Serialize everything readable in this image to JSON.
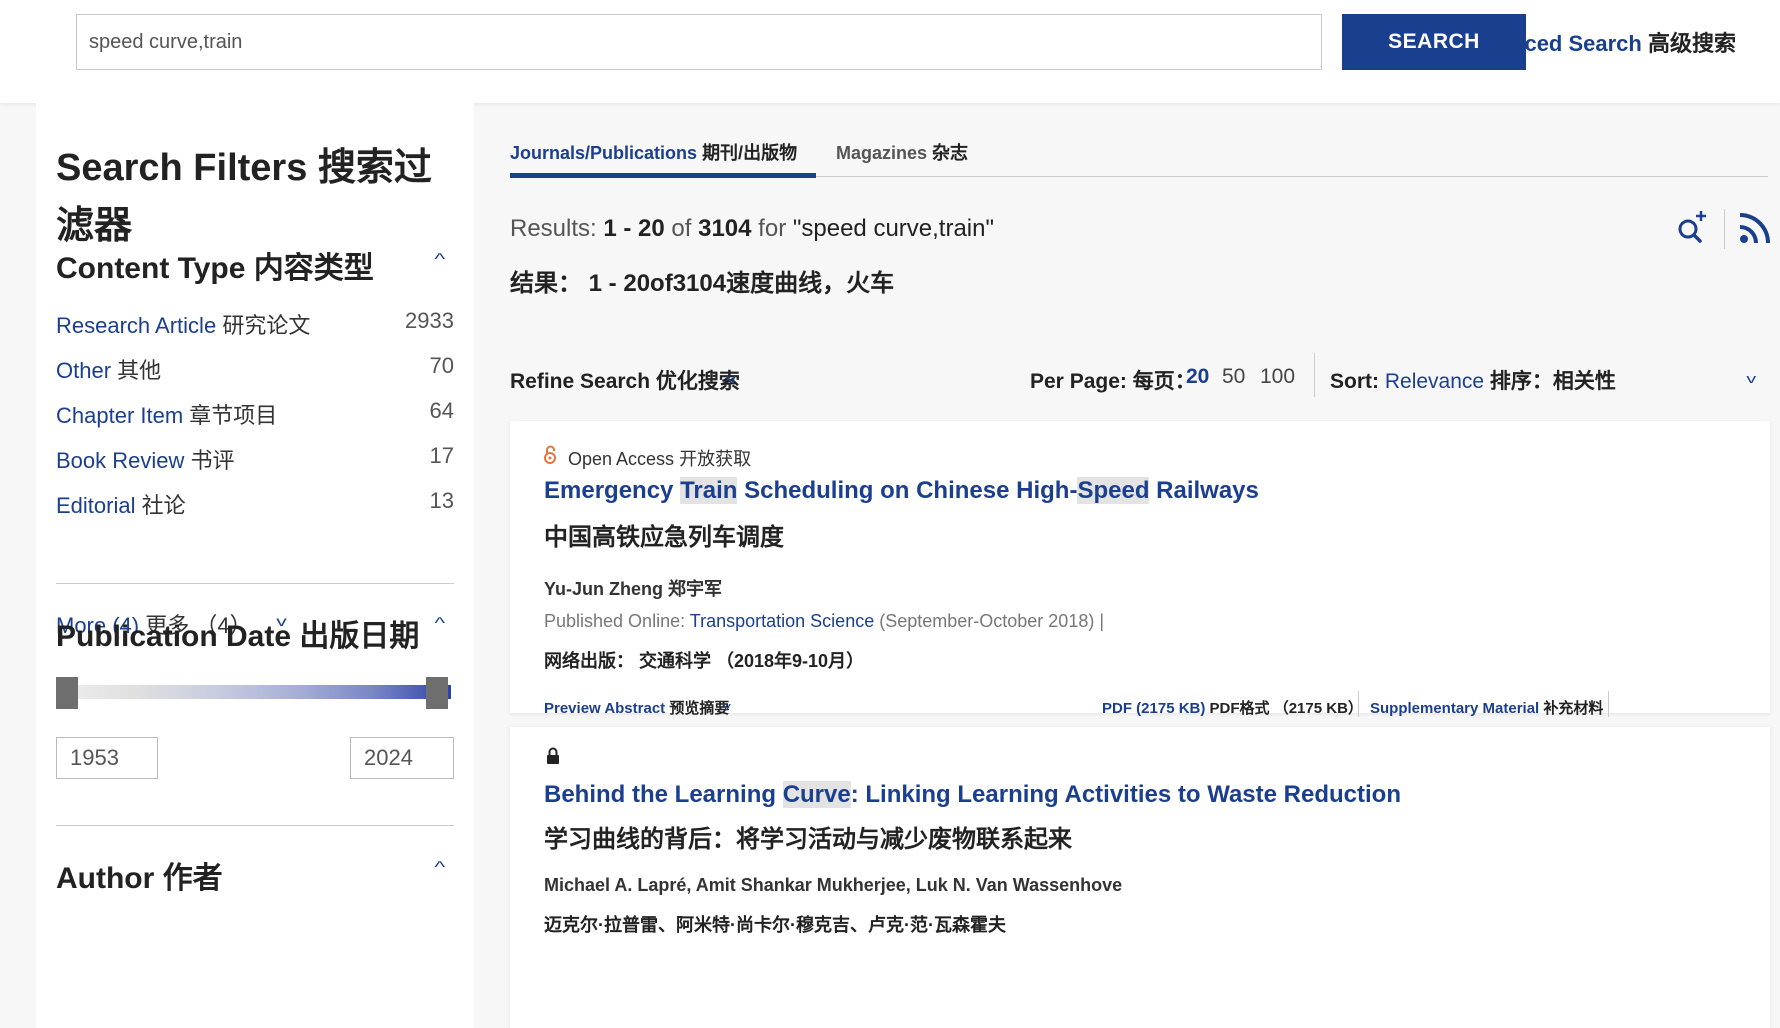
{
  "search": {
    "value": "speed curve,train",
    "button_label": "SEARCH",
    "advanced_label": "Advanced Search",
    "advanced_label_cn": "高级搜索"
  },
  "sidebar": {
    "title": "Search Filters 搜索过滤器",
    "content_type": {
      "heading": "Content Type 内容类型",
      "items": [
        {
          "label": "Research Article",
          "label_cn": "研究论文",
          "count": "2933"
        },
        {
          "label": "Other",
          "label_cn": "其他",
          "count": "70"
        },
        {
          "label": "Chapter Item",
          "label_cn": "章节项目",
          "count": "64"
        },
        {
          "label": "Book Review",
          "label_cn": "书评",
          "count": "17"
        },
        {
          "label": "Editorial",
          "label_cn": "社论",
          "count": "13"
        }
      ],
      "more_label": "More (4)",
      "more_label_cn": "更多 （4）"
    },
    "publication_date": {
      "heading": "Publication Date 出版日期",
      "from_year": "1953",
      "to_year": "2024"
    },
    "author": {
      "heading": "Author 作者"
    }
  },
  "tabs": [
    {
      "label": "Journals/Publications",
      "label_cn": "期刊/出版物"
    },
    {
      "label": "Magazines",
      "label_cn": "杂志"
    }
  ],
  "results": {
    "prefix": "Results:",
    "range": "1 - 20",
    "of": "of",
    "total": "3104",
    "for": "for",
    "query": "\"speed curve,train\"",
    "summary_cn": "结果： 1 - 20of3104速度曲线，火车"
  },
  "toolbar": {
    "refine_label": "Refine Search",
    "refine_label_cn": "优化搜索",
    "per_page_label": "Per Page: 每页：",
    "per_page_options": [
      "20",
      "50",
      "100"
    ],
    "sort_label": "Sort:",
    "sort_value": "Relevance",
    "sort_label_cn": "排序：相关性"
  },
  "articles": [
    {
      "access": "Open Access",
      "access_cn": "开放获取",
      "title_parts": [
        "Emergency ",
        "Train",
        " Scheduling on Chinese High-",
        "Speed",
        " Railways"
      ],
      "title_cn": "中国高铁应急列车调度",
      "authors": "Yu-Jun Zheng 郑宇军",
      "published_label": "Published Online:",
      "journal": "Transportation Science",
      "date": "(September-October 2018)",
      "published_cn": "网络出版： 交通科学 （2018年9-10月）",
      "preview_label": "Preview Abstract",
      "preview_label_cn": "预览摘要",
      "pdf_label": "PDF (2175 KB)",
      "pdf_label_cn": "PDF格式 （2175 KB）",
      "supp_label": "Supplementary Material",
      "supp_label_cn": "补充材料"
    },
    {
      "title_parts": [
        "Behind the Learning ",
        "Curve",
        ": Linking Learning Activities to Waste Reduction"
      ],
      "title_cn": "学习曲线的背后：将学习活动与减少废物联系起来",
      "authors": "Michael A. Lapré, Amit Shankar Mukherjee, Luk N. Van Wassenhove",
      "authors_cn": "迈克尔·拉普雷、阿米特·尚卡尔·穆克吉、卢克·范·瓦森霍夫"
    }
  ],
  "colors": {
    "brand": "#1b3f8f",
    "highlight": "#e3e3e3"
  }
}
